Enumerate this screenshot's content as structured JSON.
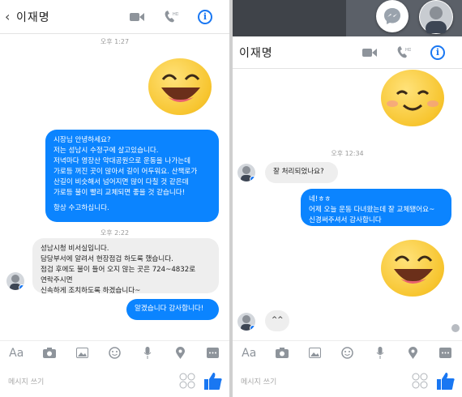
{
  "contact_name": "이재명",
  "composer_placeholder": "메시지 쓰기",
  "toolbar": {
    "aa_label": "Aa"
  },
  "colors": {
    "accent": "#1977f2",
    "my_bubble": "#0b84ff",
    "their_bubble": "#eeeeee",
    "emoji": "#f7c52f"
  },
  "left": {
    "timestamps": [
      "오후 1:27",
      "오후 2:22"
    ],
    "sent_message_lines": [
      "시장님 안녕하세요?",
      "저는 성남시 수정구에 살고있습니다.",
      "저녁마다 영장산 약대공원으로 운동을 나가는데",
      "가로등 꺼진 곳이 많아서 길이 어두워요. 산책로가",
      "산길이 비슷해서 넘어지면 많이 다칠 것 같은데",
      "가로등 불이 빨리 교체되면 좋을 것 같습니다!",
      "",
      "항상 수고하십니다."
    ],
    "received_message_lines": [
      "성남시청 비서실입니다.",
      "담당부서에 알려서 현장점검 하도록 했습니다.",
      "점검 후에도 불이 들어 오지 않는 곳은 724~4832로",
      "연락주시면",
      "신속하게 조치하도록 하겠습니다~"
    ],
    "reply_message": "알겠습니다 감사합니다!"
  },
  "right": {
    "timestamp": "오후 12:34",
    "received_question": "잘 처리되었나요?",
    "sent_message_lines": [
      "네!ㅎㅎ",
      "어제 오늘 운동 다녀왔는데 잘 교체됐어요~",
      "신경써주셔서 감사합니다"
    ],
    "received_reply": "^^"
  },
  "icons": [
    "back-chevron-icon",
    "video-camera-icon",
    "phone-hd-icon",
    "info-icon",
    "messenger-icon",
    "camera-icon",
    "photo-icon",
    "emoji-icon",
    "microphone-icon",
    "location-pin-icon",
    "more-icon",
    "sticker-icon",
    "thumbs-up-icon"
  ]
}
